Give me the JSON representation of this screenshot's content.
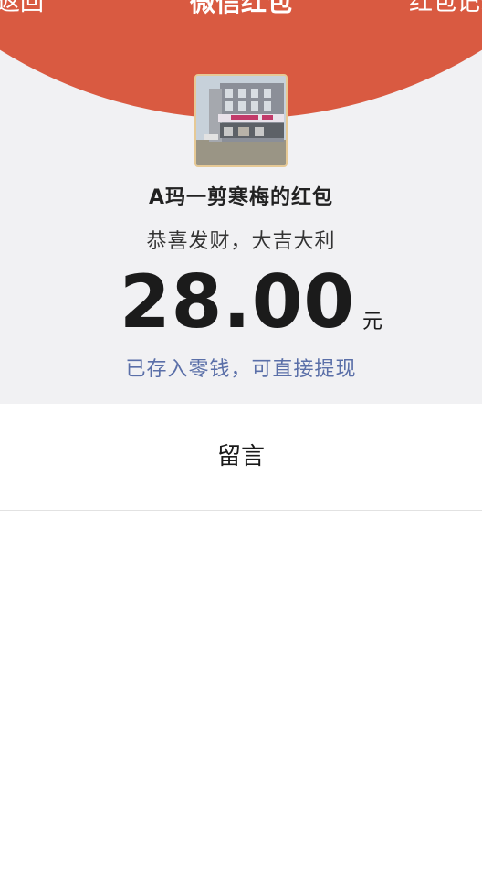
{
  "nav": {
    "back_label": "返回",
    "title": "微信红包",
    "records_label": "红包记录"
  },
  "envelope": {
    "sender_title": "A玛一剪寒梅的红包",
    "wish": "恭喜发财，大吉大利",
    "amount": "28.00",
    "unit": "元",
    "saved_note": "已存入零钱，可直接提现"
  },
  "actions": {
    "message_label": "留言"
  },
  "colors": {
    "header_red": "#d95a41",
    "background_gray": "#f1f1f3",
    "link_blue": "#5a6fa8",
    "avatar_border": "#e6c995"
  }
}
